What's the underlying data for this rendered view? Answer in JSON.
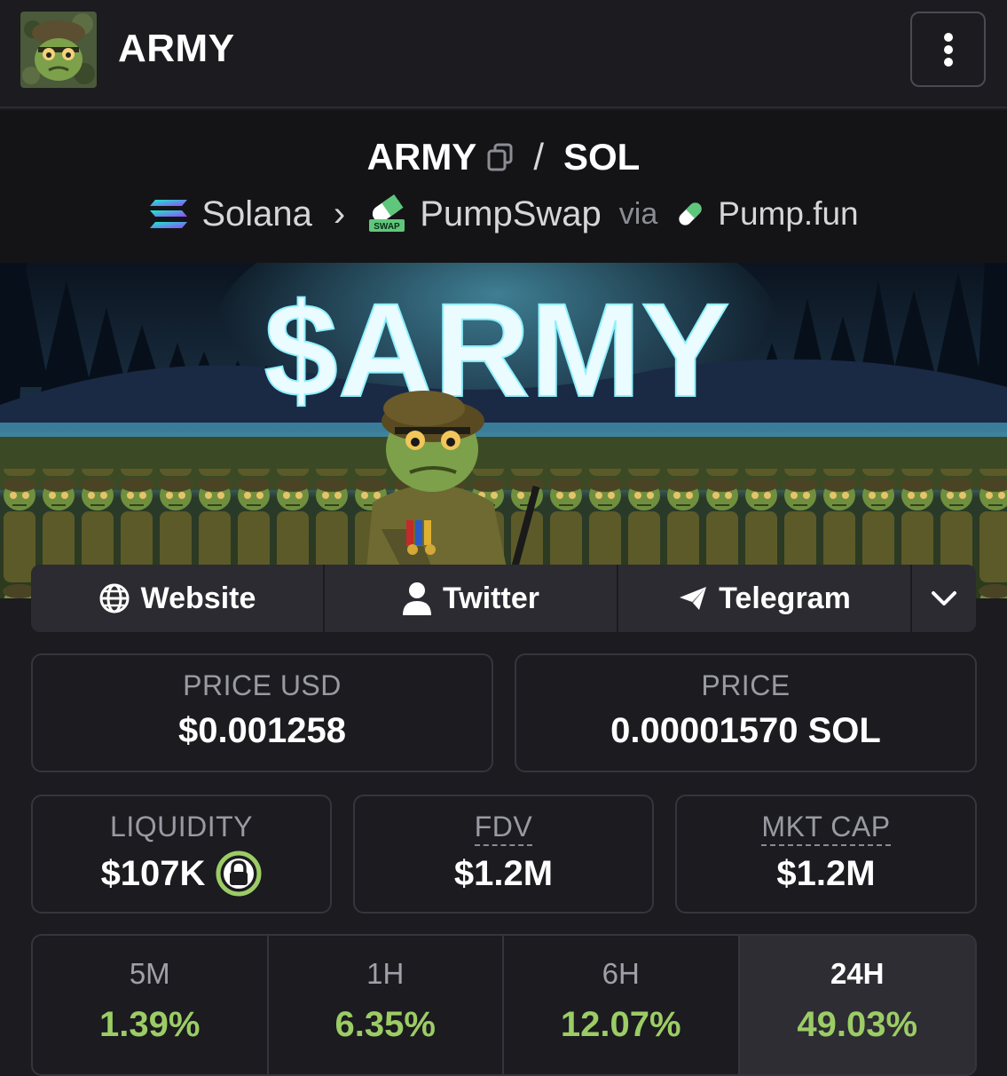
{
  "header": {
    "app_title": "ARMY",
    "menu_icon": "kebab-menu-icon"
  },
  "pair": {
    "base": "ARMY",
    "separator": "/",
    "quote": "SOL",
    "chain": "Solana",
    "dex": "PumpSwap",
    "dex_badge": "SWAP",
    "via_label": "via",
    "launchpad": "Pump.fun"
  },
  "banner": {
    "headline": "$ARMY"
  },
  "links": {
    "website": "Website",
    "twitter": "Twitter",
    "telegram": "Telegram"
  },
  "stats": {
    "price_usd_label": "PRICE USD",
    "price_usd_value": "$0.001258",
    "price_label": "PRICE",
    "price_value": "0.00001570 SOL",
    "liquidity_label": "LIQUIDITY",
    "liquidity_value": "$107K",
    "fdv_label": "FDV",
    "fdv_value": "$1.2M",
    "mktcap_label": "MKT CAP",
    "mktcap_value": "$1.2M"
  },
  "timeframes": [
    {
      "label": "5M",
      "value": "1.39%"
    },
    {
      "label": "1H",
      "value": "6.35%"
    },
    {
      "label": "6H",
      "value": "12.07%"
    },
    {
      "label": "24H",
      "value": "49.03%"
    }
  ],
  "colors": {
    "background": "#1b1b20",
    "positive": "#9ccc65",
    "border": "#35353d"
  }
}
